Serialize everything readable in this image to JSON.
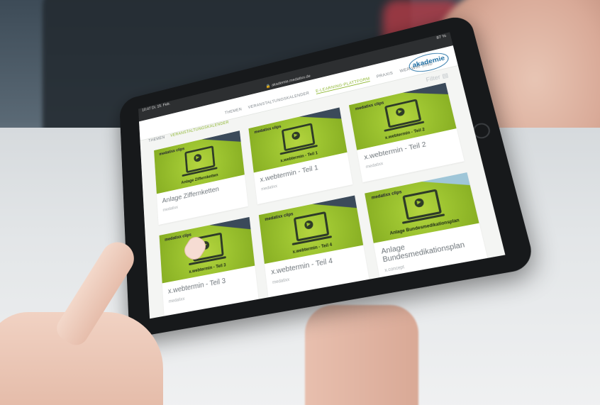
{
  "status": {
    "time": "10:47",
    "date": "Di. 15. Feb.",
    "battery": "87 %"
  },
  "url": "akademie.medatixx.de",
  "logo": "akademie",
  "top_nav": [
    "THEMEN",
    "VERANSTALTUNGSKALENDER",
    "E-LEARNING-PLATTFORM",
    "PRAXIS",
    "WER WIR SIND"
  ],
  "sub_nav": [
    "THEMEN",
    "VERANSTALTUNGSKALENDER"
  ],
  "filter_label": "Filter",
  "cards": [
    {
      "thumb_caption": "Anlage Ziffernketten",
      "title": "Anlage Ziffernketten",
      "meta": "medatixx"
    },
    {
      "thumb_caption": "x.webtermin - Teil 1",
      "title": "x.webtermin - Teil 1",
      "meta": "medatixx"
    },
    {
      "thumb_caption": "x.webtermin - Teil 2",
      "title": "x.webtermin - Teil 2",
      "meta": "medatixx"
    },
    {
      "thumb_caption": "x.webtermin - Teil 3",
      "title": "x.webtermin - Teil 3",
      "meta": "medatixx"
    },
    {
      "thumb_caption": "x.webtermin - Teil 4",
      "title": "x.webtermin - Teil 4",
      "meta": "medatixx"
    },
    {
      "thumb_caption": "Anlage Bundesmedikationsplan",
      "title": "Anlage Bundesmedikationsplan",
      "meta": "x.concept"
    }
  ],
  "thumb_brand": "medatixx clips"
}
